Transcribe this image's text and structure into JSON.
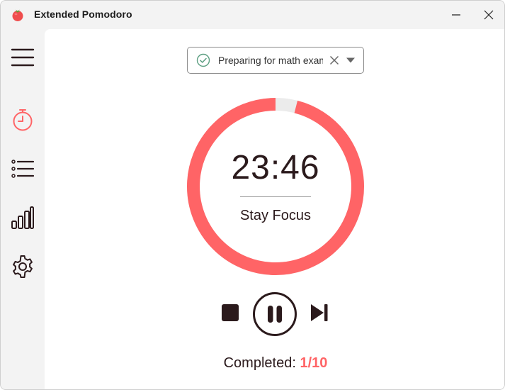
{
  "window": {
    "title": "Extended Pomodoro",
    "app_icon": "tomato-icon"
  },
  "sidebar": {
    "items": [
      {
        "name": "menu",
        "icon": "hamburger-menu-icon"
      },
      {
        "name": "timer",
        "icon": "stopwatch-icon",
        "active": true
      },
      {
        "name": "tasks",
        "icon": "list-icon"
      },
      {
        "name": "stats",
        "icon": "bar-chart-icon"
      },
      {
        "name": "settings",
        "icon": "gear-icon"
      }
    ]
  },
  "task": {
    "value": "Preparing for math exam",
    "status_icon": "check-circle-icon",
    "clear_icon": "close-icon",
    "dropdown_icon": "caret-down-icon"
  },
  "timer": {
    "time": "23:46",
    "label": "Stay Focus",
    "elapsed_fraction": 0.04
  },
  "controls": {
    "stop_icon": "stop-icon",
    "pause_icon": "pause-icon",
    "skip_icon": "skip-next-icon"
  },
  "completed": {
    "label": "Completed:",
    "count": "1/10"
  },
  "colors": {
    "accent": "#ff6466",
    "text": "#2b1a1c",
    "ring_track": "#ebebeb"
  }
}
